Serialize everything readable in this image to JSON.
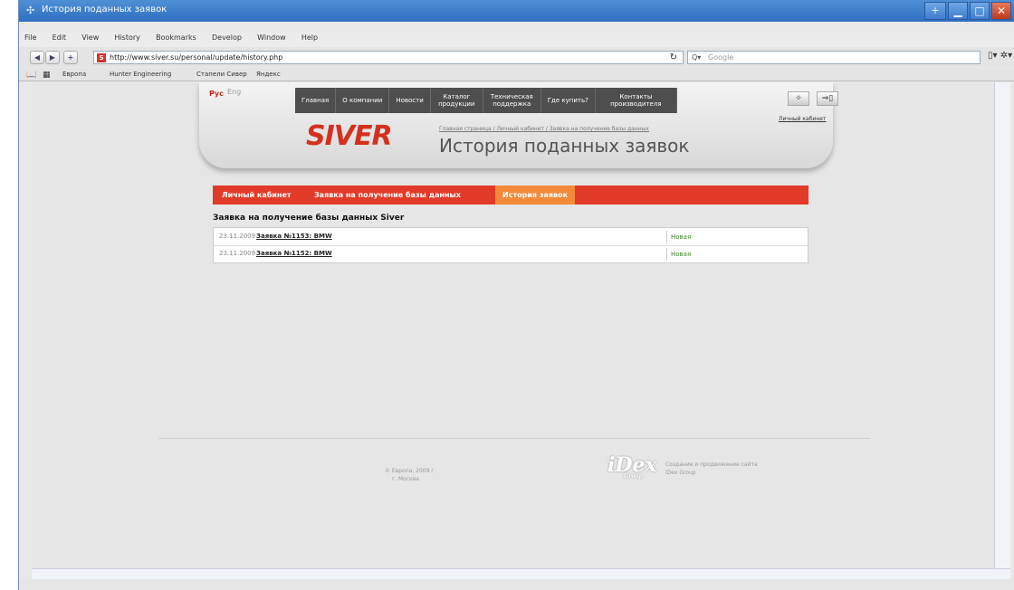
{
  "window": {
    "title": "История поданных заявок"
  },
  "menu": [
    "File",
    "Edit",
    "View",
    "History",
    "Bookmarks",
    "Develop",
    "Window",
    "Help"
  ],
  "toolbar": {
    "url": "http://www.siver.su/personal/update/history.php",
    "search_placeholder": "Google"
  },
  "bookmarks": [
    "Европа",
    "Hunter Engineering",
    "Стапели Сивер",
    "Яндекс"
  ],
  "site": {
    "lang_ru": "Рус",
    "lang_en": "Eng",
    "nav": [
      "Главная",
      "О компании",
      "Новости",
      "Каталог продукции",
      "Техническая поддержка",
      "Где купить?",
      "Контакты производителя"
    ],
    "cabinet_link": "Личный кабинет",
    "logo": "SIVER",
    "breadcrumb": "Главная страница / Личный кабинет / Заявка на получение базы данных",
    "page_title": "История поданных заявок"
  },
  "tabs": [
    {
      "label": "Личный кабинет",
      "active": false
    },
    {
      "label": "Заявка на получение базы данных",
      "active": false
    },
    {
      "label": "История заявок",
      "active": true
    }
  ],
  "section_title": "Заявка на получение базы данных Siver",
  "requests": [
    {
      "date": "23.11.2009",
      "title": "Заявка №1153: BMW",
      "status": "Новая"
    },
    {
      "date": "23.11.2009",
      "title": "Заявка №1152: BMW",
      "status": "Новая"
    }
  ],
  "footer": {
    "copyright_line1": "© Европа, 2009 г.",
    "copyright_line2": "г. Москва",
    "dev_logo": "iDex",
    "dev_logo_sub": "Group",
    "dev_line1": "Создание и продвижение сайта",
    "dev_line2": "iDex Group"
  }
}
